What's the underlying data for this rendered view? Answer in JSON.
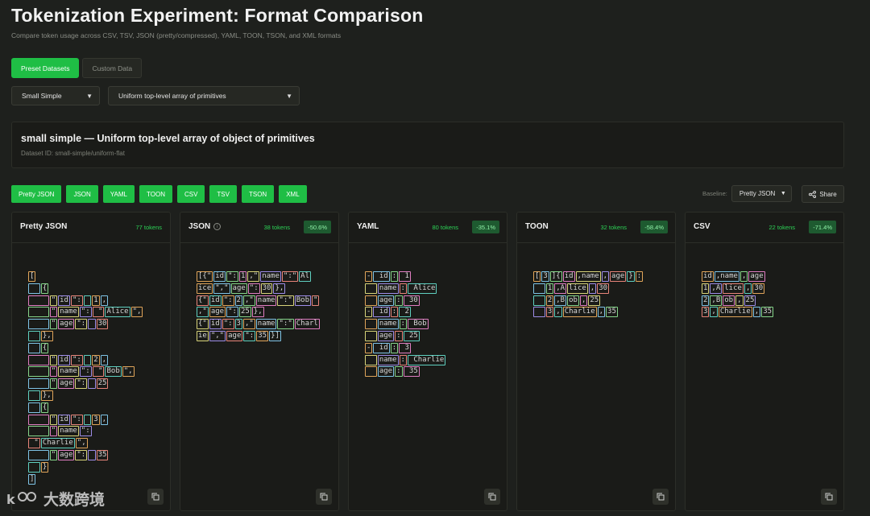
{
  "title": "Tokenization Experiment: Format Comparison",
  "subtitle": "Compare token usage across CSV, TSV, JSON (pretty/compressed), YAML, TOON, TSON, and XML formats",
  "mode_tabs": [
    "Preset Datasets",
    "Custom Data"
  ],
  "dataset_select": "Small Simple",
  "structure_select": "Uniform top-level array of primitives",
  "info": {
    "title": "small simple — Uniform top-level array of object of primitives",
    "dataset_id": "Dataset ID: small-simple/uniform-flat"
  },
  "format_buttons": [
    "Pretty JSON",
    "JSON",
    "YAML",
    "TOON",
    "CSV",
    "TSV",
    "TSON",
    "XML"
  ],
  "baseline_label": "Baseline:",
  "baseline_value": "Pretty JSON",
  "share_label": "Share",
  "token_colors": [
    "#e0a55a",
    "#7fc4e6",
    "#86d68a",
    "#e07ec2",
    "#d8d47a",
    "#9e8de8",
    "#e8857a",
    "#5fd0c0"
  ],
  "panels": [
    {
      "name": "Pretty JSON",
      "tokens": "77 tokens",
      "delta": "",
      "info_icon": false,
      "lines": [
        [
          "["
        ],
        [
          "  ",
          "{"
        ],
        [
          "    ",
          "\"",
          "id",
          "\":",
          " ",
          "1",
          ","
        ],
        [
          "    ",
          "\"",
          "name",
          "\":",
          " \"",
          "Alice",
          "\","
        ],
        [
          "    ",
          "\"",
          "age",
          "\":",
          " ",
          "30"
        ],
        [
          "  ",
          "},"
        ],
        [
          "  ",
          "{"
        ],
        [
          "    ",
          "\"",
          "id",
          "\":",
          " ",
          "2",
          ","
        ],
        [
          "    ",
          "\"",
          "name",
          "\":",
          " \"",
          "Bob",
          "\","
        ],
        [
          "    ",
          "\"",
          "age",
          "\":",
          " ",
          "25"
        ],
        [
          "  ",
          "},"
        ],
        [
          "  ",
          "{"
        ],
        [
          "    ",
          "\"",
          "id",
          "\":",
          " ",
          "3",
          ","
        ],
        [
          "    ",
          "\"",
          "name",
          "\":"
        ],
        [
          " \"",
          "Charlie",
          "\","
        ],
        [
          "    ",
          "\"",
          "age",
          "\":",
          " ",
          "35"
        ],
        [
          "  ",
          "}"
        ],
        [
          "]"
        ]
      ]
    },
    {
      "name": "JSON",
      "tokens": "38 tokens",
      "delta": "-50.6%",
      "info_icon": true,
      "lines": [
        [
          "[{\"",
          "id",
          "\":",
          "1",
          ",\"",
          "name",
          "\":\"",
          "Al"
        ],
        [
          "ice",
          "\",\"",
          "age",
          "\":",
          "30",
          "},"
        ],
        [
          "{\"",
          "id",
          "\":",
          "2",
          ",\"",
          "name",
          "\":\"",
          "Bob",
          "\""
        ],
        [
          ",\"",
          "age",
          "\":",
          "25",
          "},"
        ],
        [
          "{\"",
          "id",
          "\":",
          "3",
          ",\"",
          "name",
          "\":\"",
          "Charl"
        ],
        [
          "ie",
          "\",\"",
          "age",
          "\":",
          "35",
          "}]"
        ]
      ]
    },
    {
      "name": "YAML",
      "tokens": "80 tokens",
      "delta": "-35.1%",
      "info_icon": false,
      "lines": [
        [
          "-",
          " id",
          ":",
          " 1"
        ],
        [
          "  ",
          "name",
          ":",
          " Alice"
        ],
        [
          "  ",
          "age",
          ":",
          " 30"
        ],
        [
          "-",
          " id",
          ":",
          " 2"
        ],
        [
          "  ",
          "name",
          ":",
          " Bob"
        ],
        [
          "  ",
          "age",
          ":",
          " 25"
        ],
        [
          "-",
          " id",
          ":",
          " 3"
        ],
        [
          "  ",
          "name",
          ":",
          " Charlie"
        ],
        [
          "  ",
          "age",
          ":",
          " 35"
        ]
      ]
    },
    {
      "name": "TOON",
      "tokens": "32 tokens",
      "delta": "-58.4%",
      "info_icon": false,
      "lines": [
        [
          "[",
          "3",
          "]{",
          "id",
          ",name",
          ",",
          "age",
          "}",
          ":"
        ],
        [
          "  ",
          "1",
          ",A",
          "lice",
          ",",
          "30"
        ],
        [
          "  ",
          "2",
          ",B",
          "ob",
          ",",
          "25"
        ],
        [
          "  ",
          "3",
          ",",
          "Charlie",
          ",",
          "35"
        ]
      ]
    },
    {
      "name": "CSV",
      "tokens": "22 tokens",
      "delta": "-71.4%",
      "info_icon": false,
      "lines": [
        [
          "id",
          ",name",
          ",",
          "age"
        ],
        [
          "1",
          ",A",
          "lice",
          ",",
          "30"
        ],
        [
          "2",
          ",B",
          "ob",
          ",",
          "25"
        ],
        [
          "3",
          ",",
          "Charlie",
          ",",
          "35"
        ]
      ]
    }
  ],
  "watermark": "大数跨境"
}
